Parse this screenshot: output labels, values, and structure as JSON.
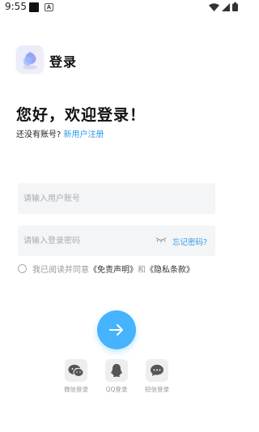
{
  "status_bar": {
    "time": "9:55",
    "notif_letter": "A"
  },
  "header": {
    "title": "登录"
  },
  "welcome": "您好，欢迎登录！",
  "register": {
    "prompt": "还没有账号?",
    "link": "新用户注册"
  },
  "form": {
    "username_placeholder": "请输入用户账号",
    "password_placeholder": "请输入登录密码",
    "forgot": "忘记密码?"
  },
  "agreement": {
    "prefix": "我已阅读并同意",
    "disclaimer": "《免责声明》",
    "and": "和",
    "privacy": "《隐私条款》",
    "checked": false
  },
  "social": [
    {
      "label": "微信登录",
      "icon": "wechat-icon"
    },
    {
      "label": "QQ登录",
      "icon": "qq-icon"
    },
    {
      "label": "短信登录",
      "icon": "sms-icon"
    }
  ],
  "colors": {
    "accent": "#45b3fd",
    "link": "#2f9be8",
    "field_bg": "#f4f5f7"
  }
}
